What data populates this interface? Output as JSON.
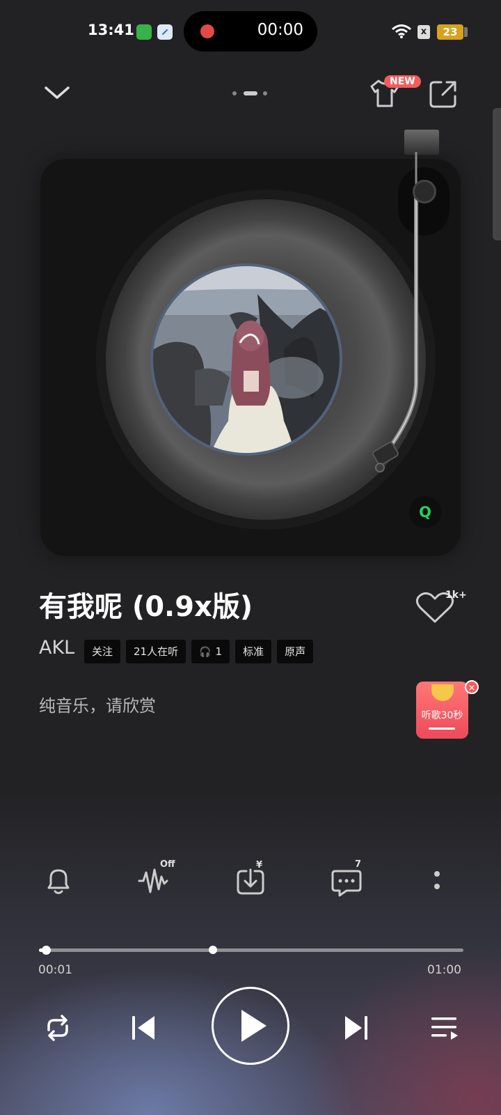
{
  "status_bar": {
    "time": "13:41",
    "recording_time": "00:00",
    "battery": "23",
    "sim_icon": "x"
  },
  "header": {
    "new_badge": "NEW",
    "icons": [
      "chevron-down-icon",
      "shirt-icon",
      "share-icon"
    ]
  },
  "turntable": {
    "logo": "Q"
  },
  "song": {
    "title": "有我呢 (0.9x版)",
    "artist": "AKL",
    "like_count": "1k+",
    "tags": {
      "follow": "关注",
      "listeners": "21人在听",
      "headphones": "1",
      "quality": "标准",
      "original": "原声"
    },
    "lyric": "纯音乐，请欣赏"
  },
  "red_packet": {
    "text": "听歌30秒",
    "close": "×"
  },
  "actions": {
    "effect_label": "Off",
    "download_label": "¥",
    "comment_count": "7"
  },
  "progress": {
    "current": "00:01",
    "total": "01:00",
    "fraction": 0.017,
    "marker_fraction": 0.41
  },
  "colors": {
    "background": "#222224",
    "accent_red": "#f25c5c",
    "qq_green": "#27d05a"
  }
}
